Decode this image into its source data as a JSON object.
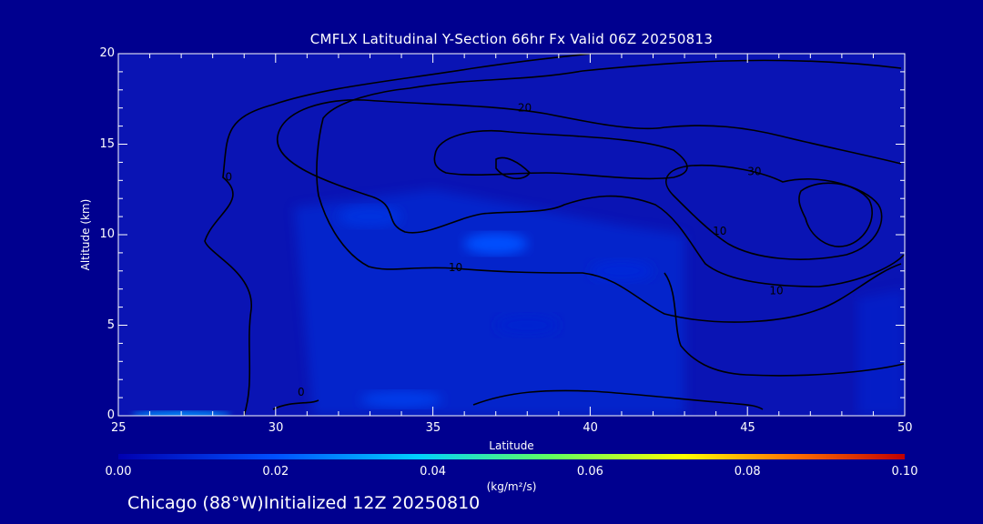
{
  "chart_data": {
    "type": "heatmap",
    "title": "CMFLX Latitudinal Y-Section 66hr  Fx Valid 06Z 20250813",
    "xlabel": "Latitude",
    "ylabel": "Altitude (km)",
    "xlim": [
      25,
      50
    ],
    "ylim": [
      0,
      20
    ],
    "xticks": [
      "25",
      "30",
      "35",
      "40",
      "45",
      "50"
    ],
    "yticks": [
      "0",
      "5",
      "10",
      "15",
      "20"
    ],
    "colorbar": {
      "label": "(kg/m²/s)",
      "min": 0.0,
      "max": 0.1,
      "ticks": [
        "0.00",
        "0.02",
        "0.04",
        "0.06",
        "0.08",
        "0.10"
      ]
    },
    "contour_labels": [
      "0",
      "10",
      "20",
      "30",
      "10",
      "10",
      "0"
    ],
    "shaded_regions": [
      {
        "x": 27,
        "y": 0.1,
        "value": 0.03
      },
      {
        "x": 34,
        "y": 0.9,
        "value": 0.015
      },
      {
        "x": 37,
        "y": 9.5,
        "value": 0.02
      },
      {
        "x": 33,
        "y": 11,
        "value": 0.012
      },
      {
        "x": 41,
        "y": 8,
        "value": 0.01
      },
      {
        "x": 38,
        "y": 5,
        "value": 0.008
      }
    ]
  },
  "footer": "Chicago (88°W)Initialized 12Z 20250810"
}
